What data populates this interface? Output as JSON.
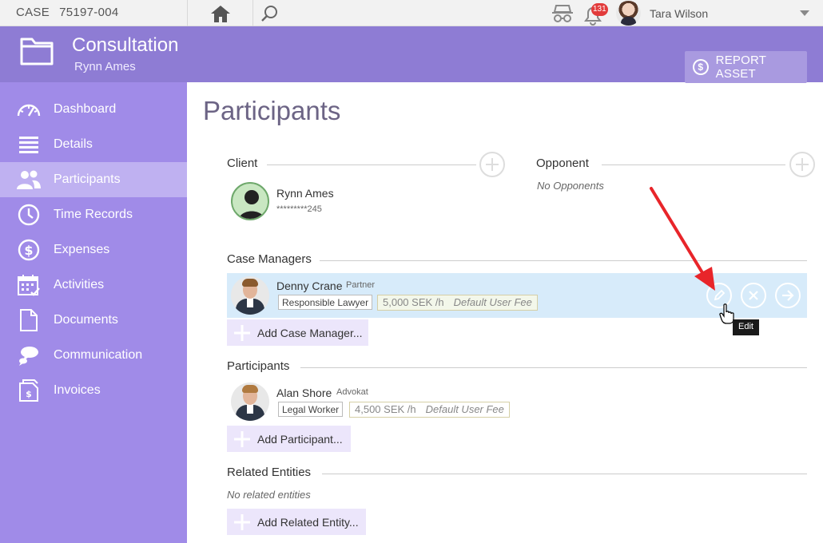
{
  "topbar": {
    "case_label": "CASE",
    "case_number": "75197-004",
    "notification_count": "131",
    "user_name": "Tara Wilson"
  },
  "header": {
    "title": "Consultation",
    "subtitle": "Rynn Ames",
    "report_button": "REPORT ASSET"
  },
  "sidebar": {
    "items": [
      {
        "label": "Dashboard",
        "icon": "dashboard-gauge-icon",
        "active": false
      },
      {
        "label": "Details",
        "icon": "list-lines-icon",
        "active": false
      },
      {
        "label": "Participants",
        "icon": "people-icon",
        "active": true
      },
      {
        "label": "Time Records",
        "icon": "clock-icon",
        "active": false
      },
      {
        "label": "Expenses",
        "icon": "dollar-circle-icon",
        "active": false
      },
      {
        "label": "Activities",
        "icon": "calendar-icon",
        "active": false
      },
      {
        "label": "Documents",
        "icon": "document-icon",
        "active": false
      },
      {
        "label": "Communication",
        "icon": "chat-bubbles-icon",
        "active": false
      },
      {
        "label": "Invoices",
        "icon": "invoice-icon",
        "active": false
      }
    ]
  },
  "main": {
    "page_title": "Participants",
    "client": {
      "section_label": "Client",
      "name": "Rynn Ames",
      "id_masked": "*********245"
    },
    "opponent": {
      "section_label": "Opponent",
      "empty_text": "No Opponents"
    },
    "case_managers": {
      "section_label": "Case Managers",
      "person": {
        "name": "Denny Crane",
        "title": "Partner",
        "role_tag": "Responsible Lawyer",
        "fee": "5,000 SEK /h",
        "fee_note": "Default User Fee"
      },
      "add_button": "Add Case Manager...",
      "tooltip": "Edit"
    },
    "participants": {
      "section_label": "Participants",
      "person": {
        "name": "Alan Shore",
        "title": "Advokat",
        "role_tag": "Legal Worker",
        "fee": "4,500 SEK /h",
        "fee_note": "Default User Fee"
      },
      "add_button": "Add Participant..."
    },
    "related_entities": {
      "section_label": "Related Entities",
      "empty_text": "No related entities",
      "add_button": "Add Related Entity..."
    }
  },
  "colors": {
    "header_purple": "#8e7cd4",
    "sidebar_purple": "#a08be8",
    "sidebar_active": "#bfb1f1",
    "row_highlight": "#d7ebfa",
    "annotation_arrow": "#e8252a"
  }
}
